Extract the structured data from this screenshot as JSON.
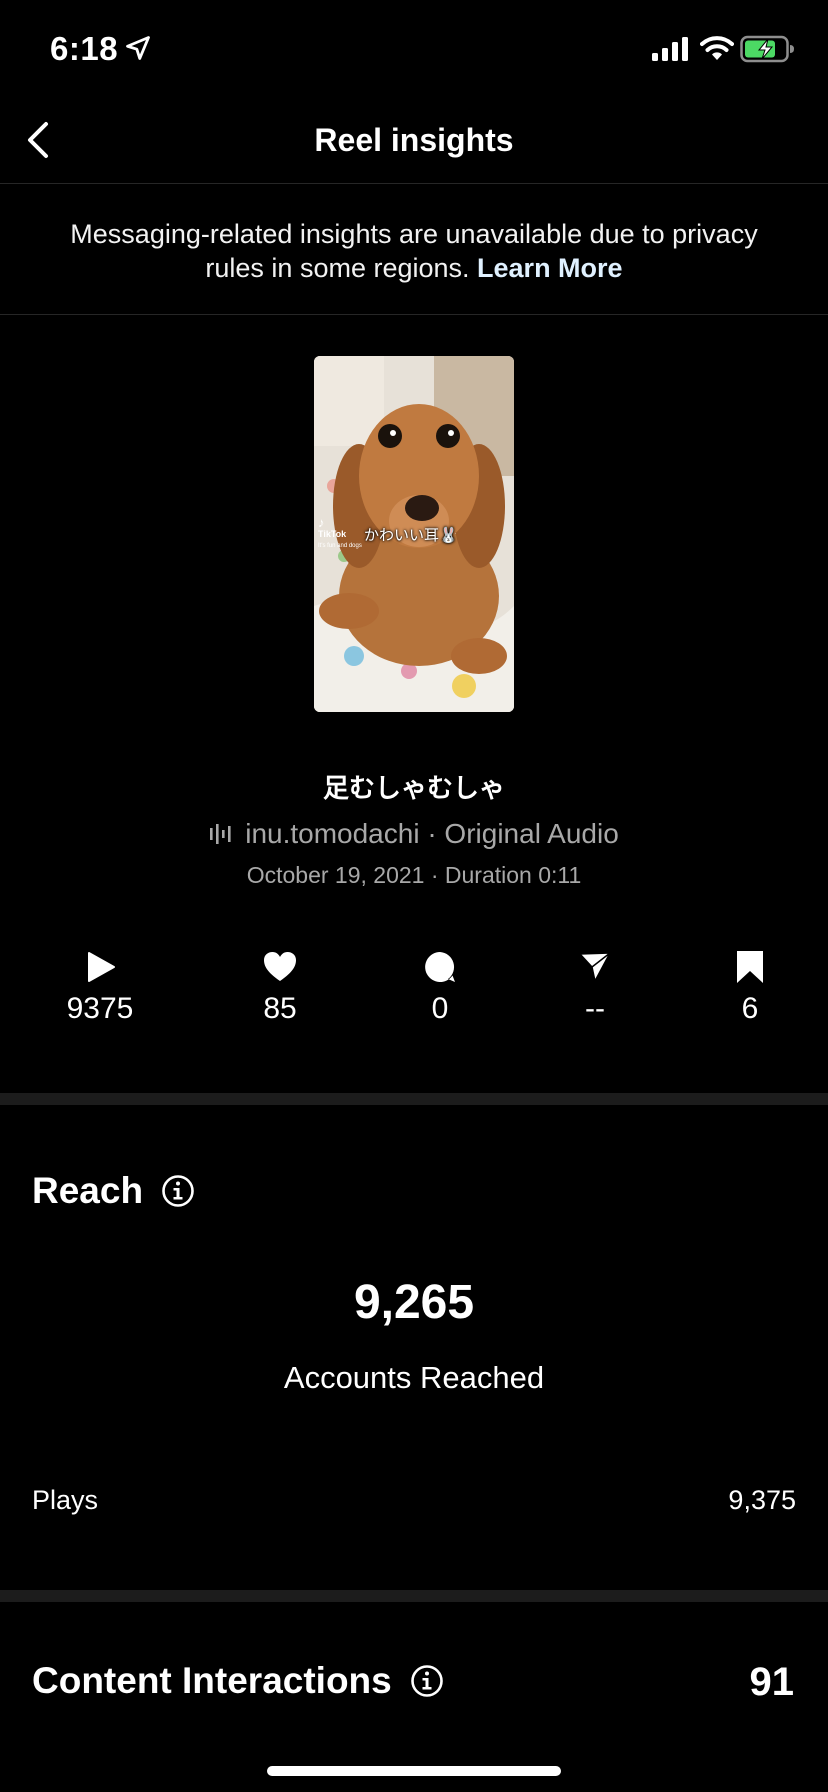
{
  "status_bar": {
    "time": "6:18"
  },
  "nav": {
    "title": "Reel insights"
  },
  "notice": {
    "text": "Messaging-related insights are unavailable due to privacy rules in some regions. ",
    "link": "Learn More"
  },
  "thumbnail": {
    "tiktok_label": "TikTok",
    "tiktok_handle": "It's fun and dogs",
    "caption": "かわいい耳🐰"
  },
  "reel": {
    "title": "足むしゃむしゃ",
    "audio": "inu.tomodachi · Original Audio",
    "meta": "October 19, 2021 · Duration 0:11"
  },
  "stats": [
    {
      "icon": "play-icon",
      "value": "9375"
    },
    {
      "icon": "heart-icon",
      "value": "85"
    },
    {
      "icon": "comment-icon",
      "value": "0"
    },
    {
      "icon": "share-icon",
      "value": "--"
    },
    {
      "icon": "bookmark-icon",
      "value": "6"
    }
  ],
  "reach": {
    "title": "Reach",
    "accounts_reached": "9,265",
    "accounts_reached_label": "Accounts Reached",
    "plays_label": "Plays",
    "plays_value": "9,375"
  },
  "content_interactions": {
    "title": "Content Interactions",
    "value": "91"
  },
  "colors": {
    "background": "#000000",
    "secondary_text": "#a8a8a8",
    "divider": "#1c1c1c",
    "battery_fill": "#4cd964"
  }
}
